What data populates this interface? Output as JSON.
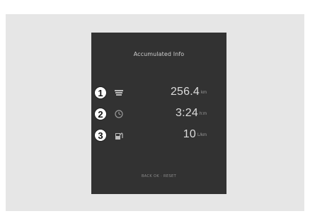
{
  "screen": {
    "title": "Accumulated Info",
    "footer": "BACK OK · RESET"
  },
  "rows": [
    {
      "badge": "1",
      "icon": "fuel-economy-icon",
      "value": "256.4",
      "unit": "km"
    },
    {
      "badge": "2",
      "icon": "clock-icon",
      "value": "3:24",
      "unit": "h:m"
    },
    {
      "badge": "3",
      "icon": "fuel-pump-icon",
      "value": "10",
      "unit": "L/km"
    }
  ],
  "colors": {
    "background": "#ffffff",
    "frame": "#e6e6e6",
    "screen": "#323232",
    "text": "#d4d4d4"
  }
}
